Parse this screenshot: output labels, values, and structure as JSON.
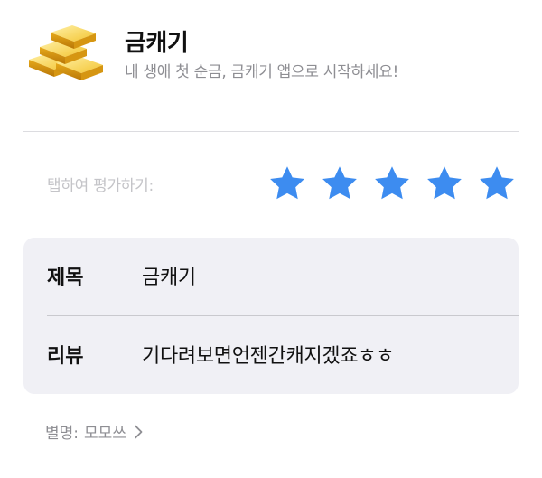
{
  "app": {
    "name": "금캐기",
    "subtitle": "내 생애 첫 순금, 금캐기 앱으로 시작하세요!",
    "icon": "gold-bars-icon"
  },
  "rating": {
    "prompt": "탭하여 평가하기:",
    "stars_filled": 5,
    "stars_total": 5,
    "star_color": "#3d8cf0"
  },
  "review": {
    "title_label": "제목",
    "title_value": "금캐기",
    "body_label": "리뷰",
    "body_value": "기다려보면언젠간캐지겠죠ㅎㅎ"
  },
  "nickname": {
    "label": "별명:",
    "value": "모모쓰",
    "icon": "chevron-right-icon"
  }
}
